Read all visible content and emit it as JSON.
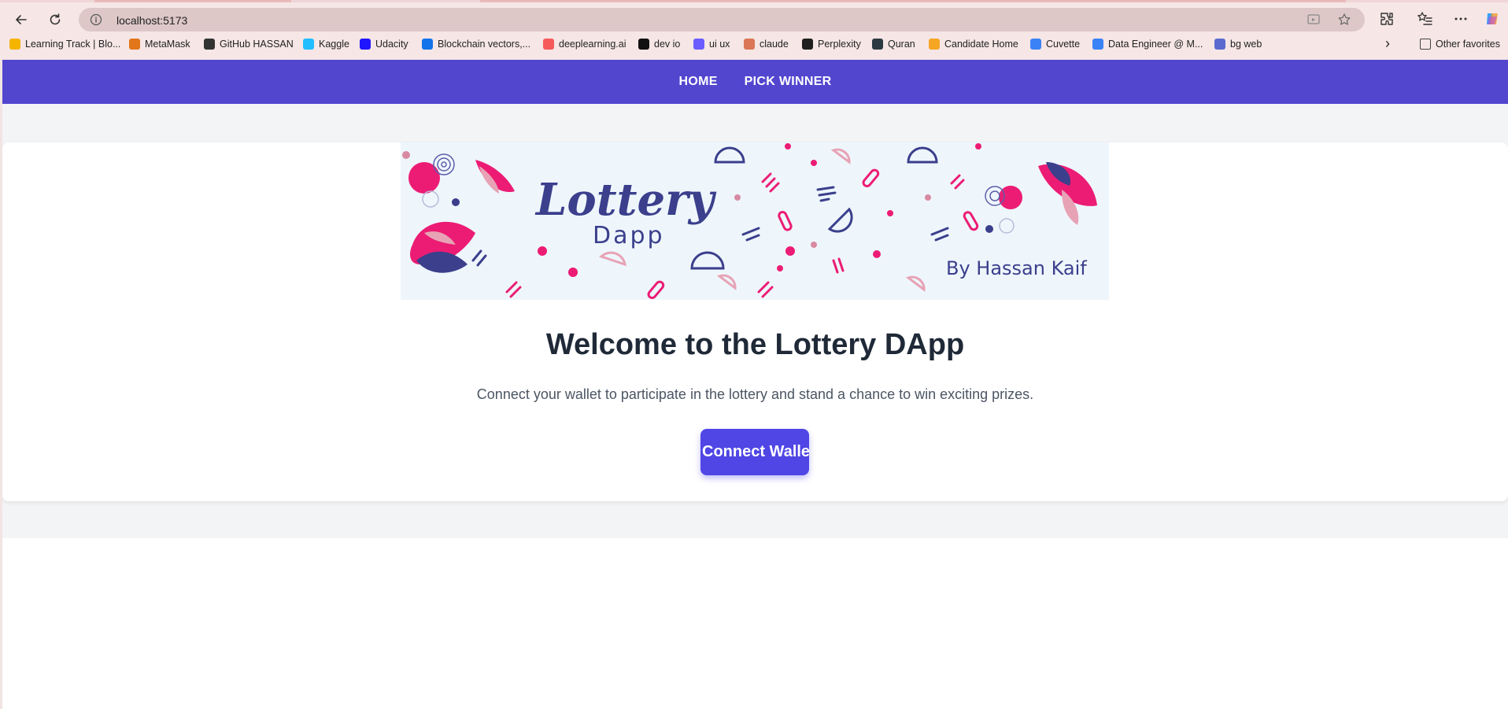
{
  "browser": {
    "url": "localhost:5173",
    "bookmarks": [
      {
        "label": "Learning Track | Blo...",
        "icon": "chart-bars-icon",
        "color": "#f4b400"
      },
      {
        "label": "MetaMask",
        "icon": "fox-icon",
        "color": "#e2761b"
      },
      {
        "label": "GitHub HASSAN",
        "icon": "github-icon",
        "color": "#333333"
      },
      {
        "label": "Kaggle",
        "icon": "kaggle-icon",
        "color": "#20beff"
      },
      {
        "label": "Udacity",
        "icon": "udacity-icon",
        "color": "#2015ff"
      },
      {
        "label": "Blockchain vectors,...",
        "icon": "freepik-icon",
        "color": "#1273eb"
      },
      {
        "label": "deeplearning.ai",
        "icon": "deeplearning-icon",
        "color": "#f65a5b"
      },
      {
        "label": "dev io",
        "icon": "dev-icon",
        "color": "#111111"
      },
      {
        "label": "ui ux",
        "icon": "uiux-icon",
        "color": "#6b5cff"
      },
      {
        "label": "claude",
        "icon": "claude-icon",
        "color": "#d97757"
      },
      {
        "label": "Perplexity",
        "icon": "perplexity-icon",
        "color": "#1f1f1f"
      },
      {
        "label": "Quran",
        "icon": "quran-icon",
        "color": "#2b3a42"
      },
      {
        "label": "Candidate Home",
        "icon": "workday-icon",
        "color": "#f5a623"
      },
      {
        "label": "Cuvette",
        "icon": "cuvette-icon",
        "color": "#3b82f6"
      },
      {
        "label": "Data Engineer @ M...",
        "icon": "doc-icon",
        "color": "#3b82f6"
      },
      {
        "label": "bg web",
        "icon": "hash-icon",
        "color": "#5a6acf"
      }
    ],
    "other_favorites": "Other favorites"
  },
  "navbar": {
    "home": "HOME",
    "pick_winner": "PICK WINNER",
    "bg_color": "#5246cf"
  },
  "banner": {
    "title": "Lottery",
    "subtitle": "Dapp",
    "author": "By Hassan Kaif"
  },
  "main": {
    "headline": "Welcome to the Lottery DApp",
    "subtext": "Connect your wallet to participate in the lottery and stand a chance to win exciting prizes.",
    "connect_label": "Connect Wallet"
  }
}
